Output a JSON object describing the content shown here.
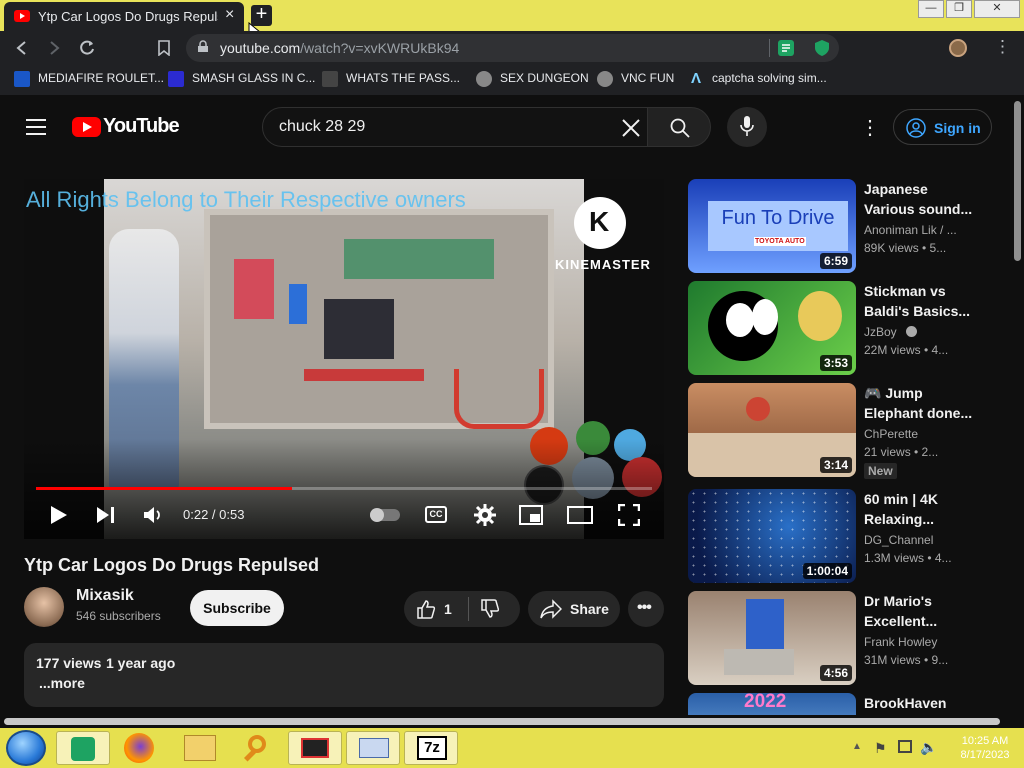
{
  "browser": {
    "tab_title": "Ytp Car Logos Do Drugs Repulsed",
    "tab_close": "×",
    "new_tab": "+",
    "url_domain": "youtube.com",
    "url_path": "/watch?v=xvKWRUkBk94",
    "bookmarks": [
      {
        "label": "MEDIAFIRE ROULET...",
        "icon": "mediafire-icon"
      },
      {
        "label": "SMASH GLASS IN C...",
        "icon": "sigma-icon"
      },
      {
        "label": "WHATS THE PASS...",
        "icon": "mask-icon"
      },
      {
        "label": "SEX DUNGEON",
        "icon": "gear-icon"
      },
      {
        "label": "VNC FUN",
        "icon": "gear-icon"
      },
      {
        "label": "captcha solving sim...",
        "icon": "a-icon"
      }
    ]
  },
  "youtube": {
    "logo_text": "YouTube",
    "search_query": "chuck 28 29",
    "signin_label": "Sign in",
    "player": {
      "overlay_text": "All Rights Belong to Their Respective owners",
      "watermark": "KINEMASTER",
      "time": "0:22 / 0:53",
      "progress": 0.415,
      "cc_label": "CC"
    },
    "video_title": "Ytp Car Logos Do Drugs Repulsed",
    "channel_name": "Mixasik",
    "subscribers": "546 subscribers",
    "subscribe_label": "Subscribe",
    "like_count": "1",
    "share_label": "Share",
    "description": {
      "views": "177 views",
      "age": "1 year ago",
      "more": "...more"
    },
    "recommendations": [
      {
        "title1": "Japanese",
        "title2": "Various sound...",
        "channel": "Anoniman Lik / ...",
        "meta": "89K views  •  5...",
        "duration": "6:59",
        "thumb_text": "Fun To Drive",
        "thumb_sub": "TOYOTA AUTO",
        "colors": [
          "#1a3fb8",
          "#6fa0ff"
        ]
      },
      {
        "title1": "Stickman vs",
        "title2": "Baldi's Basics...",
        "channel": "JzBoy",
        "verified": true,
        "meta": "22M views  •  4...",
        "duration": "3:53",
        "colors": [
          "#1f7a2e",
          "#6ccf4a"
        ]
      },
      {
        "title1": "🎮 Jump",
        "title2": "Elephant done...",
        "channel": "ChPerette",
        "meta": "21 views  •  2...",
        "badge": "New",
        "duration": "3:14",
        "colors": [
          "#c98d63",
          "#7a4a2f"
        ]
      },
      {
        "title1": "60 min | 4K",
        "title2": "Relaxing...",
        "channel": "DG_Channel",
        "meta": "1.3M views  •  4...",
        "duration": "1:00:04",
        "colors": [
          "#0a1a4a",
          "#2a70c8"
        ]
      },
      {
        "title1": "Dr Mario's",
        "title2": "Excellent...",
        "channel": "Frank Howley",
        "meta": "31M views  •  9...",
        "duration": "4:56",
        "colors": [
          "#9a8270",
          "#d9cfc2"
        ]
      },
      {
        "title1": "BrookHaven",
        "title2": "",
        "channel": "",
        "meta": "",
        "duration": "",
        "thumb_text": "2022",
        "colors": [
          "#2a5fa8",
          "#9ad0ff"
        ]
      }
    ]
  },
  "taskbar": {
    "clock_time": "10:25 AM",
    "clock_date": "8/17/2023",
    "app_7z": "7z"
  }
}
